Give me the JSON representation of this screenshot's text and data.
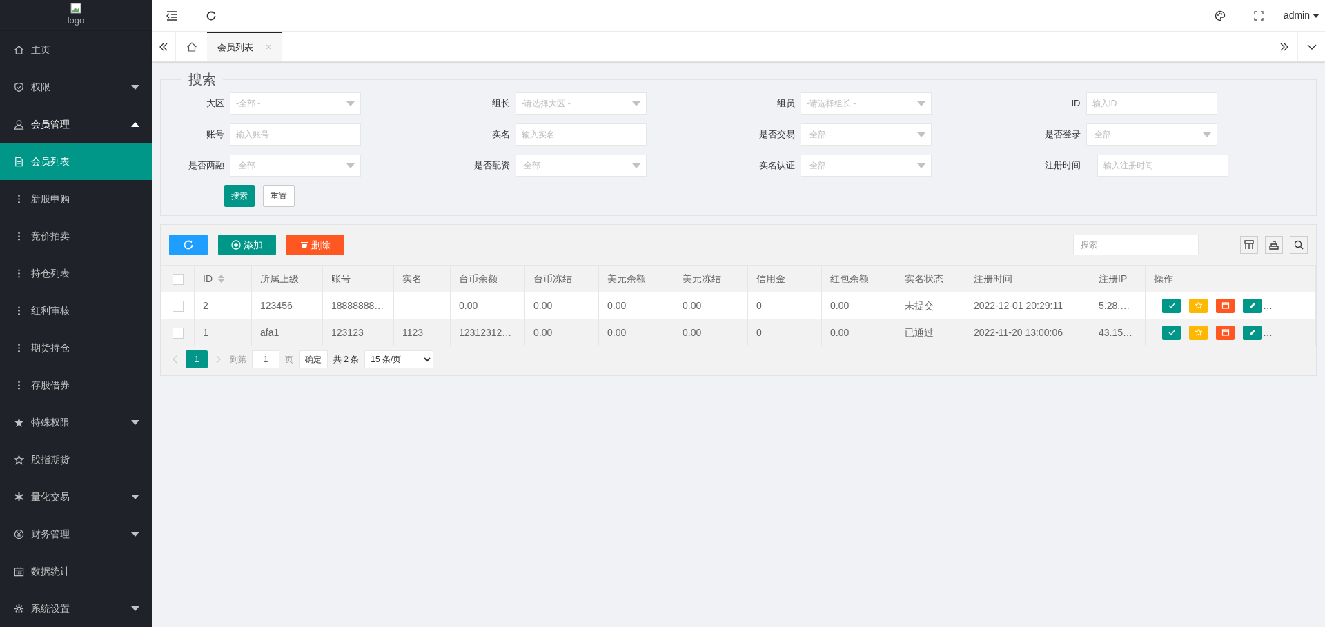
{
  "logo": {
    "alt": "logo"
  },
  "sidebar": {
    "items": [
      {
        "label": "主页",
        "selected": false
      },
      {
        "label": "权限",
        "expanded": false,
        "selected": false
      },
      {
        "label": "会员管理",
        "expanded": true,
        "selected": false,
        "children": [
          {
            "label": "会员列表",
            "selected": true
          },
          {
            "label": "新股申购",
            "selected": false
          },
          {
            "label": "竞价拍卖",
            "selected": false
          },
          {
            "label": "持仓列表",
            "selected": false
          },
          {
            "label": "红利审核",
            "selected": false
          },
          {
            "label": "期货持仓",
            "selected": false
          },
          {
            "label": "存股借券",
            "selected": false
          }
        ]
      },
      {
        "label": "特殊权限",
        "expanded": false,
        "selected": false
      },
      {
        "label": "股指期货",
        "selected": false
      },
      {
        "label": "量化交易",
        "expanded": false,
        "selected": false
      },
      {
        "label": "财务管理",
        "expanded": false,
        "selected": false
      },
      {
        "label": "数据统计",
        "selected": false
      },
      {
        "label": "系统设置",
        "expanded": false,
        "selected": false
      }
    ]
  },
  "header": {
    "user": "admin"
  },
  "tabs": [
    {
      "label": "会员列表",
      "selected": true,
      "close": "×"
    }
  ],
  "search": {
    "legend": "搜索",
    "fields": [
      {
        "label": "大区",
        "kind": "select",
        "placeholder": "-全部 -"
      },
      {
        "label": "组长",
        "kind": "select",
        "placeholder": "-请选择大区 -"
      },
      {
        "label": "组员",
        "kind": "select",
        "placeholder": "-请选择组长 -"
      },
      {
        "label": "ID",
        "kind": "input",
        "placeholder": "输入ID"
      },
      {
        "label": "账号",
        "kind": "input",
        "placeholder": "输入账号"
      },
      {
        "label": "实名",
        "kind": "input",
        "placeholder": "输入实名"
      },
      {
        "label": "是否交易",
        "kind": "select",
        "placeholder": "-全部 -"
      },
      {
        "label": "是否登录",
        "kind": "select",
        "placeholder": "-全部 -"
      },
      {
        "label": "是否两融",
        "kind": "select",
        "placeholder": "-全部 -"
      },
      {
        "label": "是否配资",
        "kind": "select",
        "placeholder": "-全部 -"
      },
      {
        "label": "实名认证",
        "kind": "select",
        "placeholder": "-全部 -"
      },
      {
        "label": "注册时间",
        "kind": "input",
        "placeholder": "输入注册时间"
      }
    ],
    "buttons": [
      "搜索",
      "重置"
    ]
  },
  "toolbar": {
    "add": "添加",
    "delete": "删除",
    "search_placeholder": "搜索"
  },
  "table": {
    "all_checked": false,
    "columns": [
      "ID",
      "所属上级",
      "账号",
      "实名",
      "台币余额",
      "台币冻结",
      "美元余额",
      "美元冻结",
      "信用金",
      "红包余额",
      "实名状态",
      "注册时间",
      "注册IP",
      "操作"
    ],
    "rows": [
      {
        "checked": false,
        "cells": [
          "2",
          "123456",
          "18888888…",
          "",
          "0.00",
          "0.00",
          "0.00",
          "0.00",
          "0",
          "0.00",
          "未提交",
          "2022-12-01 20:29:11",
          "5.28.…"
        ],
        "more": "…"
      },
      {
        "checked": false,
        "cells": [
          "1",
          "afa1",
          "123123",
          "1123",
          "12312312…",
          "0.00",
          "0.00",
          "0.00",
          "0",
          "0.00",
          "已通过",
          "2022-11-20 13:00:06",
          "43.15…"
        ],
        "more": "…"
      }
    ]
  },
  "pager": {
    "pages": [
      {
        "label": "1",
        "selected": true
      }
    ],
    "goto": "到第",
    "page_value": "1",
    "page_unit": "页",
    "confirm": "确定",
    "total": "共 2 条",
    "size": "15 条/页"
  }
}
